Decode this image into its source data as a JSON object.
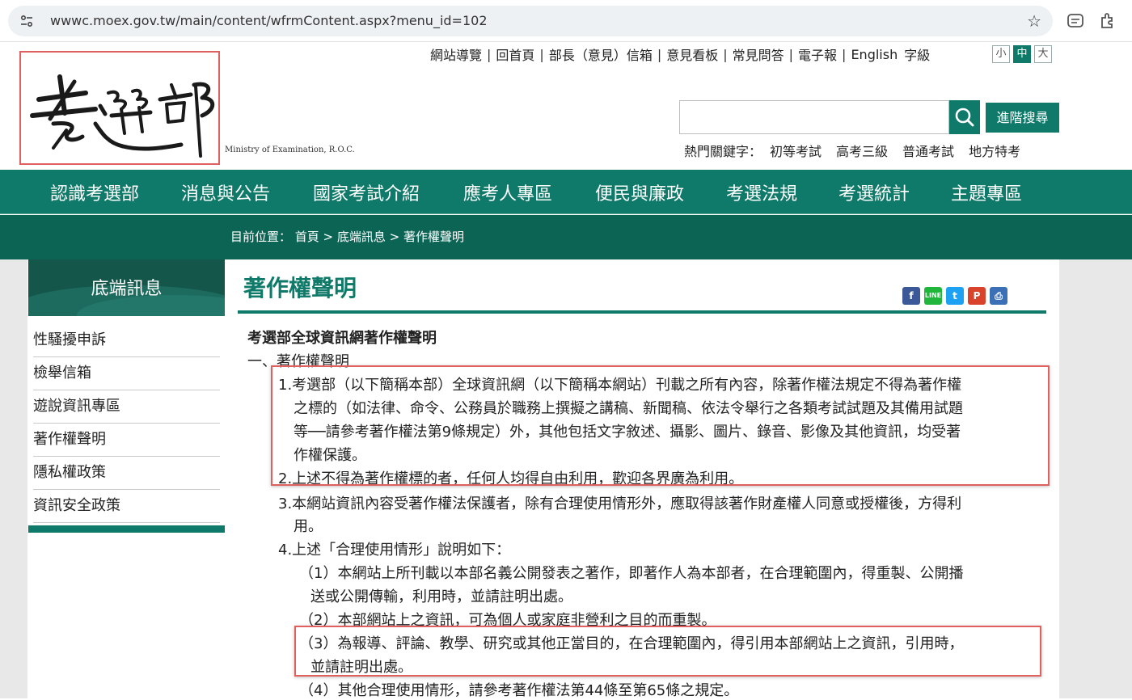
{
  "browser": {
    "url": "wwwc.moex.gov.tw/main/content/wfrmContent.aspx?menu_id=102"
  },
  "header": {
    "logo_caption": "Ministry of Examination, R.O.C.",
    "top_links": [
      "網站導覽",
      "回首頁",
      "部長（意見）信箱",
      "意見看板",
      "常見問答",
      "電子報",
      "English"
    ],
    "font_size_label": "字級",
    "font_sizes": [
      "小",
      "中",
      "大"
    ],
    "advanced_search": "進階搜尋",
    "hot_keywords_label": "熱門關鍵字：",
    "hot_keywords": [
      "初等考試",
      "高考三級",
      "普通考試",
      "地方特考"
    ]
  },
  "nav": [
    "認識考選部",
    "消息與公告",
    "國家考試介紹",
    "應考人專區",
    "便民與廉政",
    "考選法規",
    "考選統計",
    "主題專區"
  ],
  "breadcrumb": "目前位置： 首頁 > 底端訊息 > 著作權聲明",
  "sidebar": {
    "title": "底端訊息",
    "items": [
      "性騷擾申訴",
      "檢舉信箱",
      "遊說資訊專區",
      "著作權聲明",
      "隱私權政策",
      "資訊安全政策"
    ]
  },
  "content": {
    "title": "著作權聲明",
    "share_icons": [
      "f",
      "LINE",
      "t",
      "P",
      "⎙"
    ],
    "lines": [
      "考選部全球資訊網著作權聲明",
      "一、著作權聲明",
      "1.考選部（以下簡稱本部）全球資訊網（以下簡稱本網站）刊載之所有內容，除著作權法規定不得為著作權",
      "之標的（如法律、命令、公務員於職務上撰擬之講稿、新聞稿、依法令舉行之各類考試試題及其備用試題",
      "等──請參考著作權法第9條規定）外，其他包括文字敘述、攝影、圖片、錄音、影像及其他資訊，均受著",
      "作權保護。",
      "2.上述不得為著作權標的者，任何人均得自由利用，歡迎各界廣為利用。",
      "3.本網站資訊內容受著作權法保護者，除有合理使用情形外，應取得該著作財產權人同意或授權後，方得利",
      "用。",
      "4.上述「合理使用情形」說明如下：",
      "（1）本網站上所刊載以本部名義公開發表之著作，即著作人為本部者，在合理範圍內，得重製、公開播",
      "送或公開傳輸，利用時，並請註明出處。",
      "（2）本部網站上之資訊，可為個人或家庭非營利之目的而重製。",
      "（3）為報導、評論、教學、研究或其他正當目的，在合理範圍內，得引用本部網站上之資訊，引用時，",
      "並請註明出處。",
      "（4）其他合理使用情形，請參考著作權法第44條至第65條之規定。"
    ]
  },
  "colors": {
    "brand_green": "#0f7a6a",
    "breadcrumb_green": "#0c6455",
    "highlight_red": "#e06060"
  }
}
